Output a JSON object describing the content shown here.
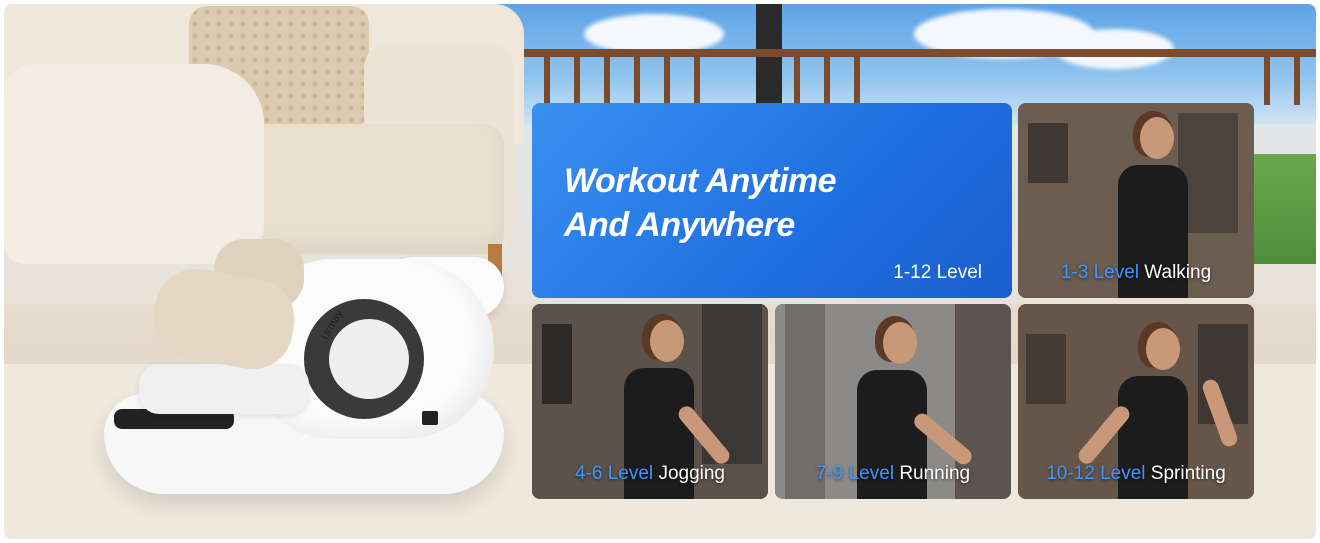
{
  "hero": {
    "title_line1": "Workout Anytime",
    "title_line2": "And Anywhere",
    "level": "1-12 Level",
    "color": "#2a7ff0"
  },
  "machine_logo": "Urmay",
  "tiles": [
    {
      "level": "1-3 Level",
      "activity": "Walking"
    },
    {
      "level": "4-6 Level",
      "activity": "Jogging"
    },
    {
      "level": "7-9 Level",
      "activity": "Running"
    },
    {
      "level": "10-12 Level",
      "activity": "Sprinting"
    }
  ],
  "accent_color": "#3f95ff"
}
